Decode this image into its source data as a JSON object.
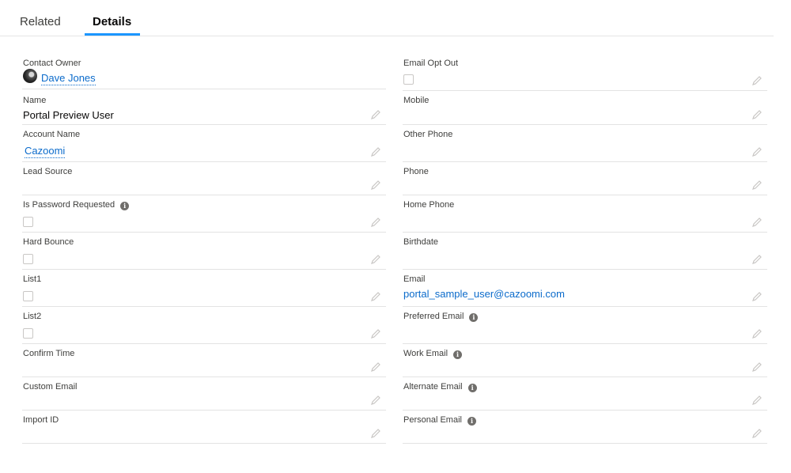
{
  "tabs": {
    "related": "Related",
    "details": "Details"
  },
  "left_fields": {
    "contact_owner": {
      "label": "Contact Owner",
      "value": "Dave Jones"
    },
    "name": {
      "label": "Name",
      "value": "Portal Preview User"
    },
    "account_name": {
      "label": "Account Name",
      "value": "Cazoomi"
    },
    "lead_source": {
      "label": "Lead Source",
      "value": ""
    },
    "is_password_requested": {
      "label": "Is Password Requested",
      "checked": false
    },
    "hard_bounce": {
      "label": "Hard Bounce",
      "checked": false
    },
    "list1": {
      "label": "List1",
      "checked": false
    },
    "list2": {
      "label": "List2",
      "checked": false
    },
    "confirm_time": {
      "label": "Confirm Time",
      "value": ""
    },
    "custom_email": {
      "label": "Custom Email",
      "value": ""
    },
    "import_id": {
      "label": "Import ID",
      "value": ""
    }
  },
  "right_fields": {
    "email_opt_out": {
      "label": "Email Opt Out",
      "checked": false
    },
    "mobile": {
      "label": "Mobile",
      "value": ""
    },
    "other_phone": {
      "label": "Other Phone",
      "value": ""
    },
    "phone": {
      "label": "Phone",
      "value": ""
    },
    "home_phone": {
      "label": "Home Phone",
      "value": ""
    },
    "birthdate": {
      "label": "Birthdate",
      "value": ""
    },
    "email": {
      "label": "Email",
      "value": "portal_sample_user@cazoomi.com"
    },
    "preferred_email": {
      "label": "Preferred Email",
      "value": ""
    },
    "work_email": {
      "label": "Work Email",
      "value": ""
    },
    "alternate_email": {
      "label": "Alternate Email",
      "value": ""
    },
    "personal_email": {
      "label": "Personal Email",
      "value": ""
    }
  },
  "icons": {
    "info": "info-icon",
    "edit": "pencil-icon",
    "avatar": "user-avatar"
  },
  "colors": {
    "accent": "#1b96ff",
    "link": "#0b6bcb"
  }
}
